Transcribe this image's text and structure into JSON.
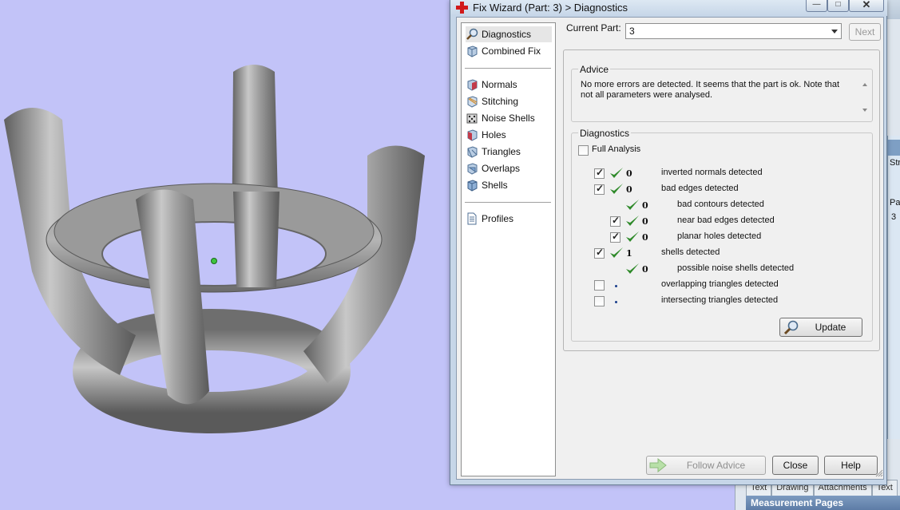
{
  "window": {
    "title": "Fix Wizard (Part: 3) > Diagnostics",
    "min_label": "—",
    "max_label": "□",
    "close_label": "✕"
  },
  "nav": {
    "group1": [
      {
        "label": "Diagnostics",
        "icon": "magnifier-icon",
        "selected": true
      },
      {
        "label": "Combined Fix",
        "icon": "cube-icon"
      }
    ],
    "group2": [
      {
        "label": "Normals",
        "icon": "normals-cube-icon"
      },
      {
        "label": "Stitching",
        "icon": "stitching-cube-icon"
      },
      {
        "label": "Noise Shells",
        "icon": "dice-icon"
      },
      {
        "label": "Holes",
        "icon": "holes-cube-icon"
      },
      {
        "label": "Triangles",
        "icon": "triangles-cube-icon"
      },
      {
        "label": "Overlaps",
        "icon": "overlaps-cube-icon"
      },
      {
        "label": "Shells",
        "icon": "shells-cube-icon"
      }
    ],
    "group3": [
      {
        "label": "Profiles",
        "icon": "document-icon"
      }
    ]
  },
  "current_part": {
    "label": "Current Part:",
    "value": "3",
    "next_label": "Next"
  },
  "advice": {
    "title": "Advice",
    "text": "No more errors are detected. It seems that the part is ok. Note that not all parameters were analysed."
  },
  "diagnostics": {
    "title": "Diagnostics",
    "full_analysis_label": "Full Analysis",
    "full_analysis_checked": false,
    "rows": [
      {
        "checked": true,
        "ok": true,
        "count": "0",
        "label": "inverted normals detected",
        "has_checkbox": true,
        "indent": 0
      },
      {
        "checked": true,
        "ok": true,
        "count": "0",
        "label": "bad edges detected",
        "has_checkbox": true,
        "indent": 0
      },
      {
        "checked": false,
        "ok": true,
        "count": "0",
        "label": "bad contours detected",
        "has_checkbox": false,
        "indent": 1
      },
      {
        "checked": true,
        "ok": true,
        "count": "0",
        "label": "near bad edges detected",
        "has_checkbox": true,
        "indent": 1
      },
      {
        "checked": true,
        "ok": true,
        "count": "0",
        "label": "planar holes detected",
        "has_checkbox": true,
        "indent": 1
      },
      {
        "checked": true,
        "ok": true,
        "count": "1",
        "label": "shells detected",
        "has_checkbox": true,
        "indent": 0
      },
      {
        "checked": false,
        "ok": true,
        "count": "0",
        "label": "possible noise shells detected",
        "has_checkbox": false,
        "indent": 1
      },
      {
        "checked": false,
        "ok": false,
        "count": "",
        "label": "overlapping triangles detected",
        "has_checkbox": true,
        "indent": 0
      },
      {
        "checked": false,
        "ok": false,
        "count": "",
        "label": "intersecting triangles detected",
        "has_checkbox": true,
        "indent": 0
      }
    ],
    "update_label": "Update"
  },
  "footer": {
    "follow_advice_label": "Follow Advice",
    "close_label": "Close",
    "help_label": "Help"
  },
  "background_app": {
    "tabs": [
      "Text",
      "Drawing",
      "Attachments",
      "Text"
    ],
    "measurement_label": "Measurement Pages",
    "fragment_1": "Stre",
    "fragment_2": "Pa",
    "fragment_3": "3"
  },
  "colors": {
    "viewport_bg": "#c2c3f8",
    "checkmark_green": "#2f8a2a",
    "dialog_frame": "#c6d6e8",
    "accent_red": "#d11a1a"
  }
}
